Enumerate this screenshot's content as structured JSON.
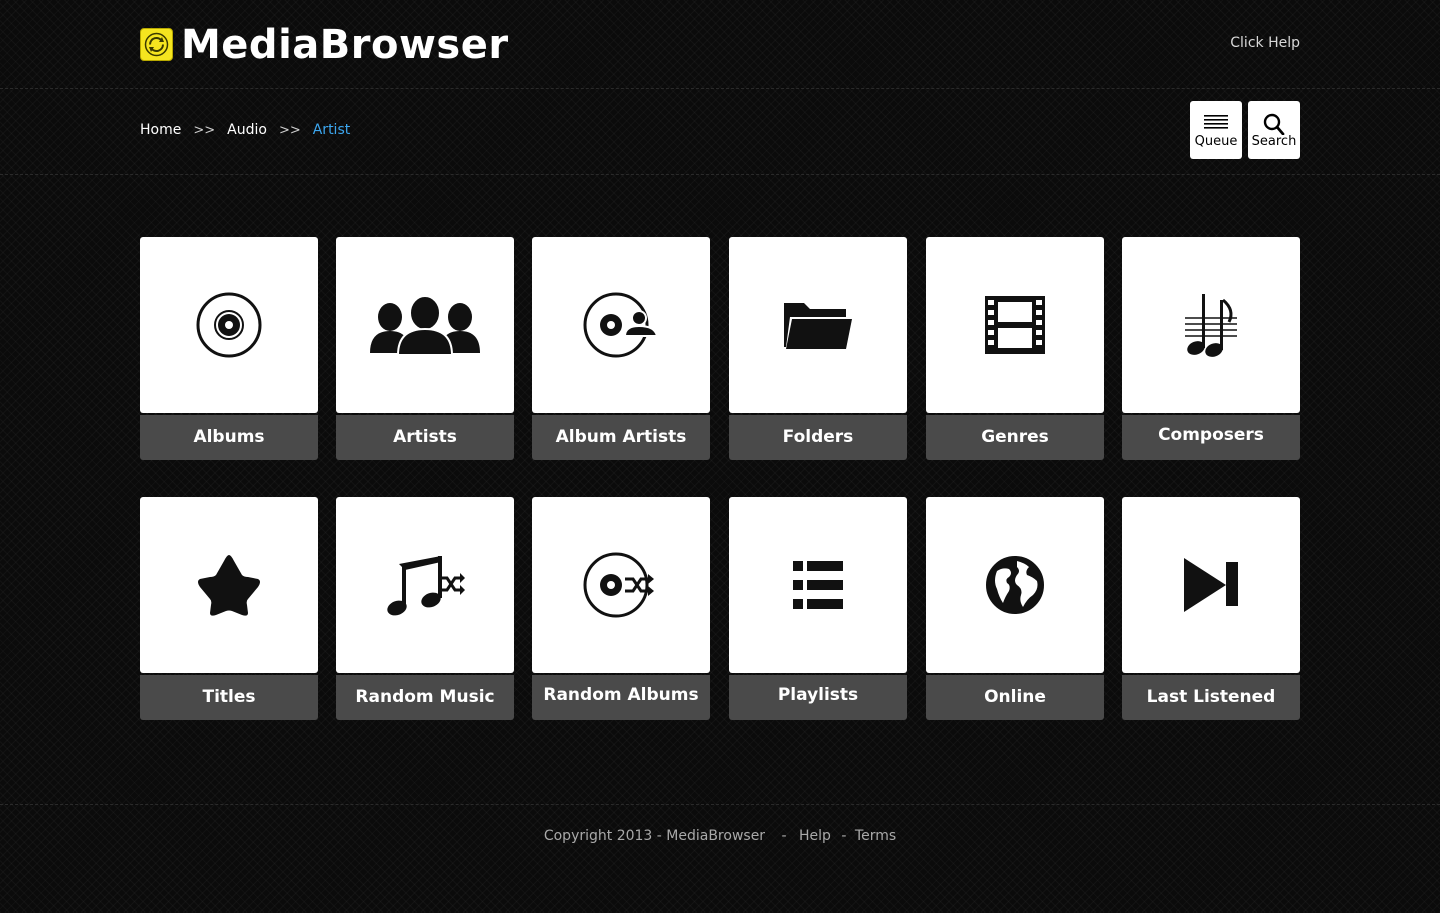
{
  "header": {
    "brand": "MediaBrowser",
    "help_link": "Click Help"
  },
  "breadcrumb": {
    "items": [
      "Home",
      "Audio",
      "Artist"
    ],
    "separator": ">>"
  },
  "toolbar": {
    "queue_label": "Queue",
    "search_label": "Search"
  },
  "tiles": [
    {
      "label": "Albums",
      "icon": "disc-icon"
    },
    {
      "label": "Artists",
      "icon": "users-icon"
    },
    {
      "label": "Album  Artists",
      "icon": "disc-user-icon"
    },
    {
      "label": "Folders",
      "icon": "folder-icon"
    },
    {
      "label": "Genres",
      "icon": "film-icon"
    },
    {
      "label": "Composers",
      "icon": "music-score-icon"
    },
    {
      "label": "Titles",
      "icon": "star-icon"
    },
    {
      "label": "Random Music",
      "icon": "music-shuffle-icon"
    },
    {
      "label": "Random Albums",
      "icon": "disc-shuffle-icon"
    },
    {
      "label": "Playlists",
      "icon": "list-icon"
    },
    {
      "label": "Online",
      "icon": "globe-icon"
    },
    {
      "label": "Last Listened",
      "icon": "skip-next-icon"
    }
  ],
  "footer": {
    "copyright": "Copyright 2013 - MediaBrowser",
    "dash1": "-",
    "help": "Help",
    "dash2": "-",
    "terms": "Terms"
  },
  "colors": {
    "background": "#0b0b0b",
    "tile_caption": "#4a4a4a",
    "breadcrumb_active": "#3ca7f0",
    "logo": "#f5e51f"
  }
}
